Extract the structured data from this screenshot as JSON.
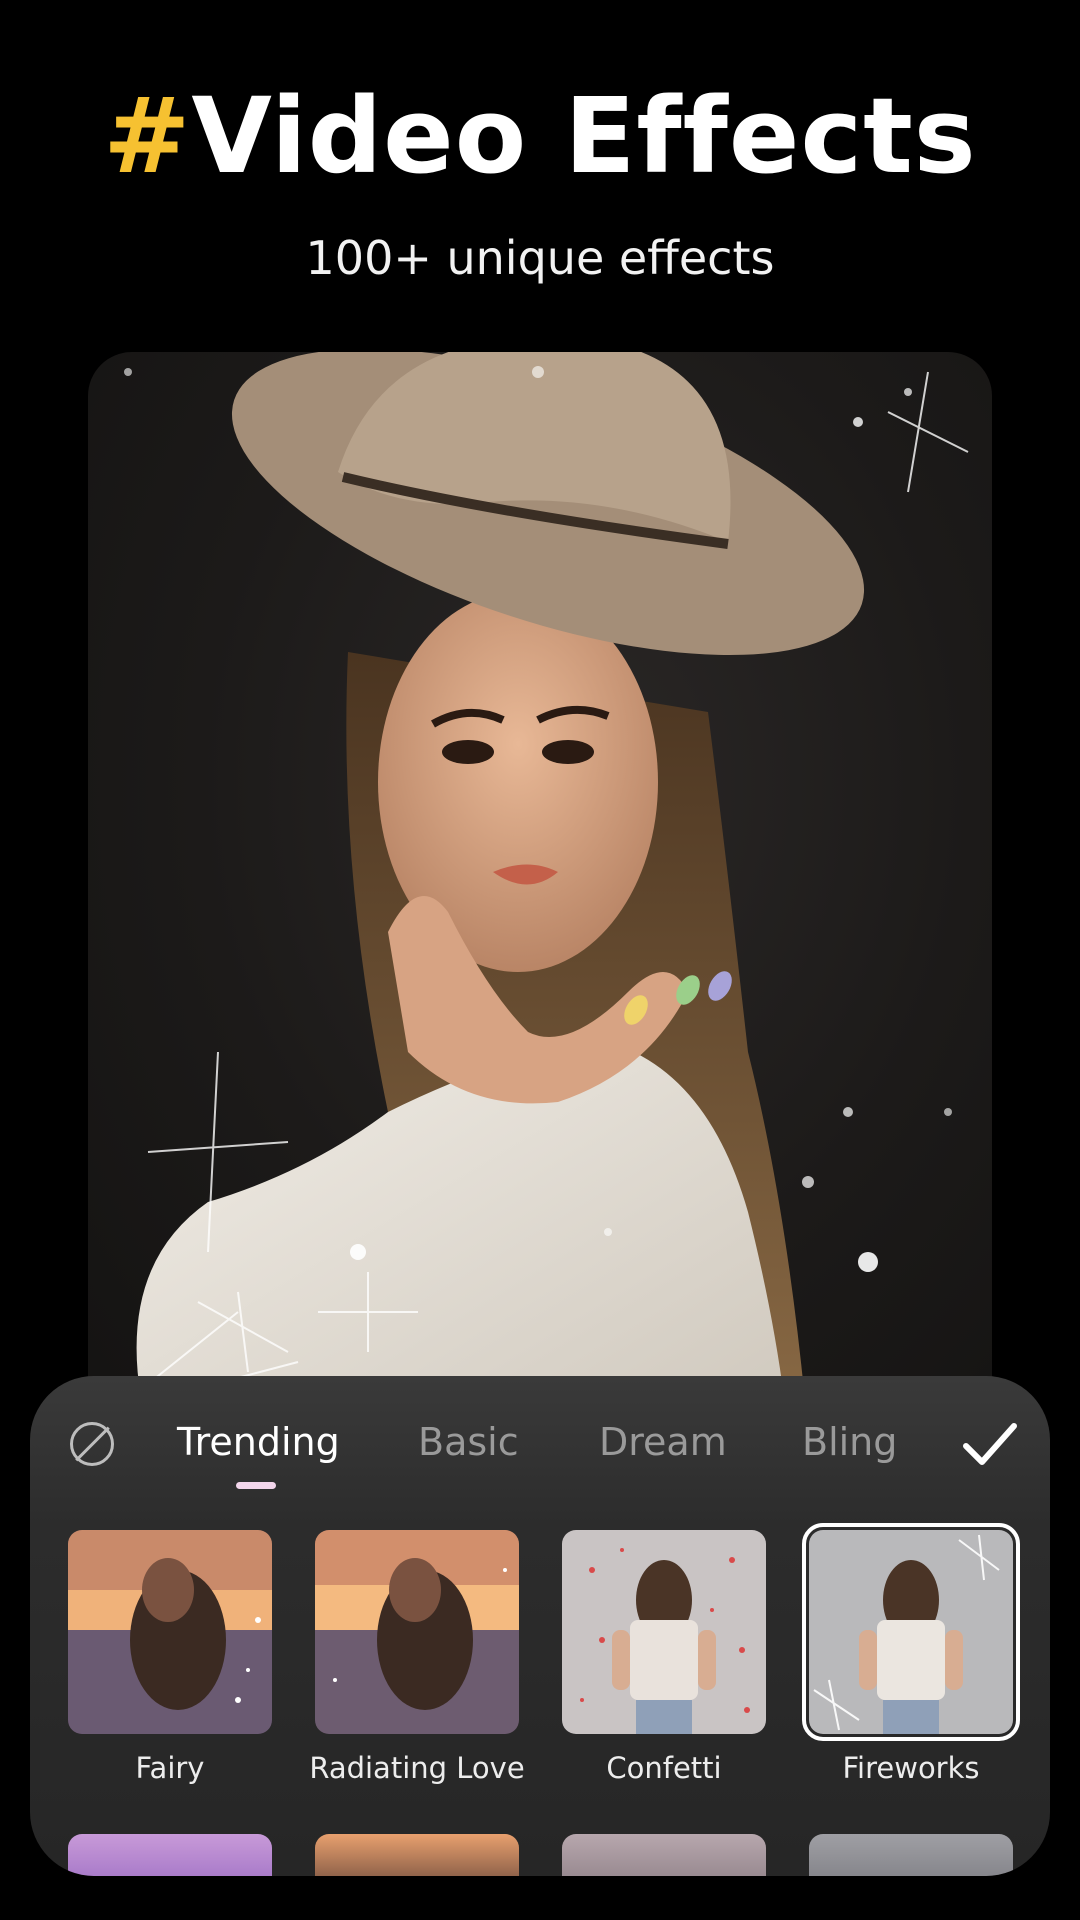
{
  "header": {
    "title_hash": "#",
    "title_text": "Video Effects",
    "subtitle": "100+ unique effects"
  },
  "preview": {
    "image": "portrait-woman-hat-sparkles"
  },
  "effects_panel": {
    "none_icon": "no-effect-icon",
    "confirm_icon": "checkmark-icon",
    "tabs": [
      {
        "label": "Trending",
        "active": true
      },
      {
        "label": "Basic",
        "active": false
      },
      {
        "label": "Dream",
        "active": false
      },
      {
        "label": "Bling",
        "active": false
      }
    ],
    "effects": [
      {
        "label": "Fairy",
        "selected": false
      },
      {
        "label": "Radiating Love",
        "selected": false
      },
      {
        "label": "Confetti",
        "selected": false
      },
      {
        "label": "Fireworks",
        "selected": true
      }
    ]
  },
  "colors": {
    "accent": "#f6c131",
    "background": "#000000",
    "panel": "#2c2c2c",
    "tab_indicator": "#f3d6ec"
  }
}
